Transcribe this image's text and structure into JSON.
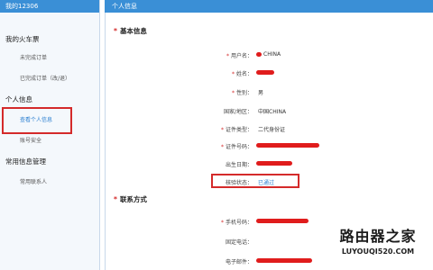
{
  "sidebar": {
    "header": "我的12306",
    "sections": [
      {
        "title": "我的火车票",
        "items": [
          "未完成订单",
          "已完成订单（改/退）"
        ]
      },
      {
        "title": "个人信息",
        "items": [
          "查看个人信息",
          "账号安全"
        ]
      },
      {
        "title": "常用信息管理",
        "items": [
          "常用联系人"
        ]
      }
    ]
  },
  "main": {
    "header": "个人信息",
    "basic": {
      "title": "基本信息",
      "rows": [
        {
          "label": "用户名：",
          "value": "CHINA"
        },
        {
          "label": "姓名：",
          "value": ""
        },
        {
          "label": "性别：",
          "value": "男"
        },
        {
          "label": "国家/地区：",
          "value": "中国CHINA"
        },
        {
          "label": "证件类型：",
          "value": "二代身份证"
        },
        {
          "label": "证件号码：",
          "value": ""
        },
        {
          "label": "出生日期：",
          "value": ""
        },
        {
          "label": "核验状态：",
          "value": "已通过"
        }
      ]
    },
    "contact": {
      "title": "联系方式",
      "rows": [
        {
          "label": "手机号码：",
          "value": ""
        },
        {
          "label": "固定电话：",
          "value": ""
        },
        {
          "label": "电子邮件：",
          "value": ""
        }
      ]
    }
  },
  "watermark": {
    "title": "路由器之家",
    "url": "LUYOUQI520.COM"
  },
  "colors": {
    "header": "#3a8fd6",
    "highlight": "#d42a2a",
    "link": "#2b7fd0"
  }
}
